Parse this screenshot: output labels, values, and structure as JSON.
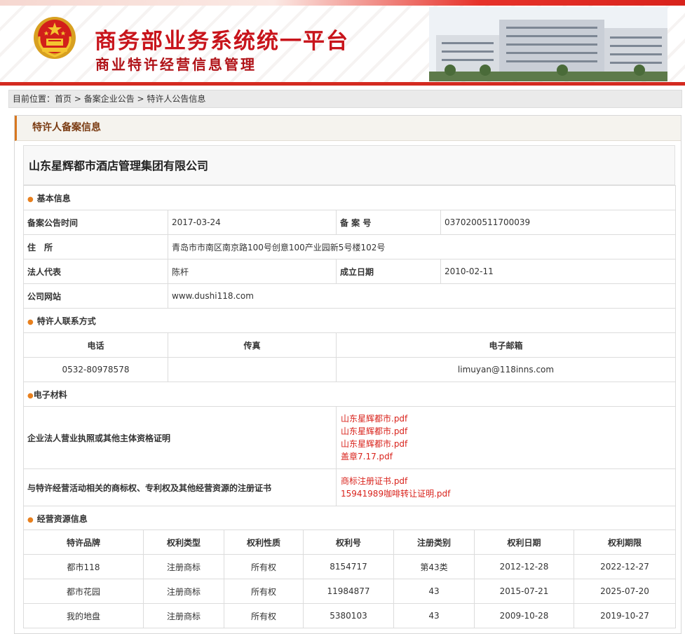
{
  "header": {
    "title_main": "商务部业务系统统一平台",
    "title_sub": "商业特许经营信息管理"
  },
  "breadcrumb": {
    "prefix": "目前位置：",
    "items": [
      "首页",
      "备案企业公告",
      "特许人公告信息"
    ],
    "separator": " > "
  },
  "panel": {
    "title": "特许人备案信息"
  },
  "company": {
    "name": "山东星辉都市酒店管理集团有限公司"
  },
  "basic": {
    "section": "基本信息",
    "date_label": "备案公告时间",
    "date_value": "2017-03-24",
    "record_label": "备 案 号",
    "record_value": "0370200511700039",
    "address_label": "住　所",
    "address_value": "青岛市市南区南京路100号创意100产业园新5号楼102号",
    "legal_label": "法人代表",
    "legal_value": "陈杆",
    "founded_label": "成立日期",
    "founded_value": "2010-02-11",
    "website_label": "公司网站",
    "website_value": "www.dushi118.com"
  },
  "contact": {
    "section": "特许人联系方式",
    "phone_label": "电话",
    "fax_label": "传真",
    "email_label": "电子邮箱",
    "phone_value": "0532-80978578",
    "fax_value": "",
    "email_value": "limuyan@118inns.com"
  },
  "materials": {
    "section": "电子材料",
    "license_label": "企业法人营业执照或其他主体资格证明",
    "license_files": [
      "山东星辉都市.pdf",
      "山东星辉都市.pdf",
      "山东星辉都市.pdf",
      "盖章7.17.pdf"
    ],
    "trademark_label": "与特许经营活动相关的商标权、专利权及其他经营资源的注册证书",
    "trademark_files": [
      "商标注册证书.pdf",
      "15941989咖啡转让证明.pdf"
    ]
  },
  "resources": {
    "section": "经营资源信息",
    "columns": [
      "特许品牌",
      "权利类型",
      "权利性质",
      "权利号",
      "注册类别",
      "权利日期",
      "权利期限"
    ],
    "rows": [
      [
        "都市118",
        "注册商标",
        "所有权",
        "8154717",
        "第43类",
        "2012-12-28",
        "2022-12-27"
      ],
      [
        "都市花园",
        "注册商标",
        "所有权",
        "11984877",
        "43",
        "2015-07-21",
        "2025-07-20"
      ],
      [
        "我的地盘",
        "注册商标",
        "所有权",
        "5380103",
        "43",
        "2009-10-28",
        "2019-10-27"
      ]
    ]
  },
  "colors": {
    "brand_red": "#c8141b",
    "accent_orange": "#e8801e",
    "link_red": "#d9231c"
  }
}
